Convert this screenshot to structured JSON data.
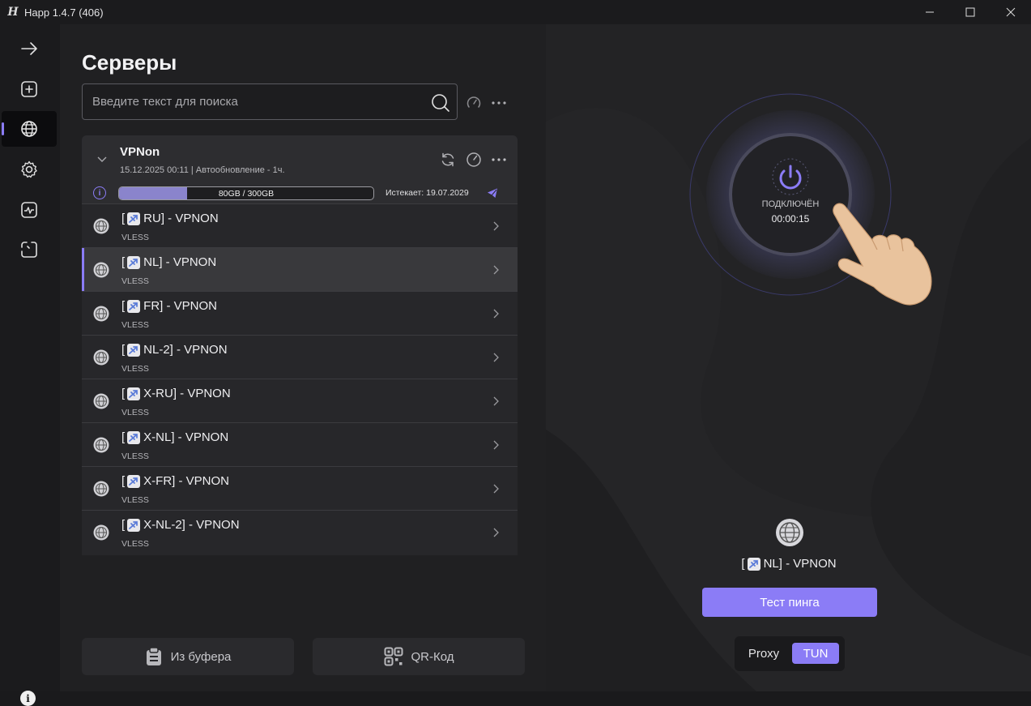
{
  "window": {
    "title": "Happ 1.4.7 (406)",
    "logo": "H"
  },
  "nav": {
    "items": [
      "arrow-right-icon",
      "add-icon",
      "globe-icon",
      "gear-icon",
      "activity-icon",
      "scan-icon"
    ],
    "active": "globe-icon",
    "info_label": "i"
  },
  "servers": {
    "title": "Серверы",
    "search_placeholder": "Введите текст для поиска",
    "group": {
      "name": "VPNon",
      "subtitle": "15.12.2025 00:11 | Автообновление - 1ч.",
      "traffic_text": "80GB / 300GB",
      "traffic_fraction": 0.267,
      "expires": "Истекает: 19.07.2029"
    },
    "rows": [
      {
        "name": "RU] - VPNON",
        "protocol": "VLESS",
        "active": false
      },
      {
        "name": "NL] - VPNON",
        "protocol": "VLESS",
        "active": true
      },
      {
        "name": "FR] - VPNON",
        "protocol": "VLESS",
        "active": false
      },
      {
        "name": "NL-2] - VPNON",
        "protocol": "VLESS",
        "active": false
      },
      {
        "name": "X-RU] - VPNON",
        "protocol": "VLESS",
        "active": false
      },
      {
        "name": "X-NL] - VPNON",
        "protocol": "VLESS",
        "active": false
      },
      {
        "name": "X-FR] - VPNON",
        "protocol": "VLESS",
        "active": false
      },
      {
        "name": "X-NL-2] - VPNON",
        "protocol": "VLESS",
        "active": false
      }
    ],
    "bracket": "[",
    "clipboard_label": "Из буфера",
    "qr_label": "QR-Код"
  },
  "connection": {
    "status": "ПОДКЛЮЧЁН",
    "timer": "00:00:15",
    "server_name": "NL] - VPNON",
    "ping_label": "Тест пинга",
    "mode_proxy": "Proxy",
    "mode_tun": "TUN",
    "active_mode": "TUN"
  },
  "colors": {
    "accent": "#8b7cf6",
    "bg": "#202022"
  }
}
